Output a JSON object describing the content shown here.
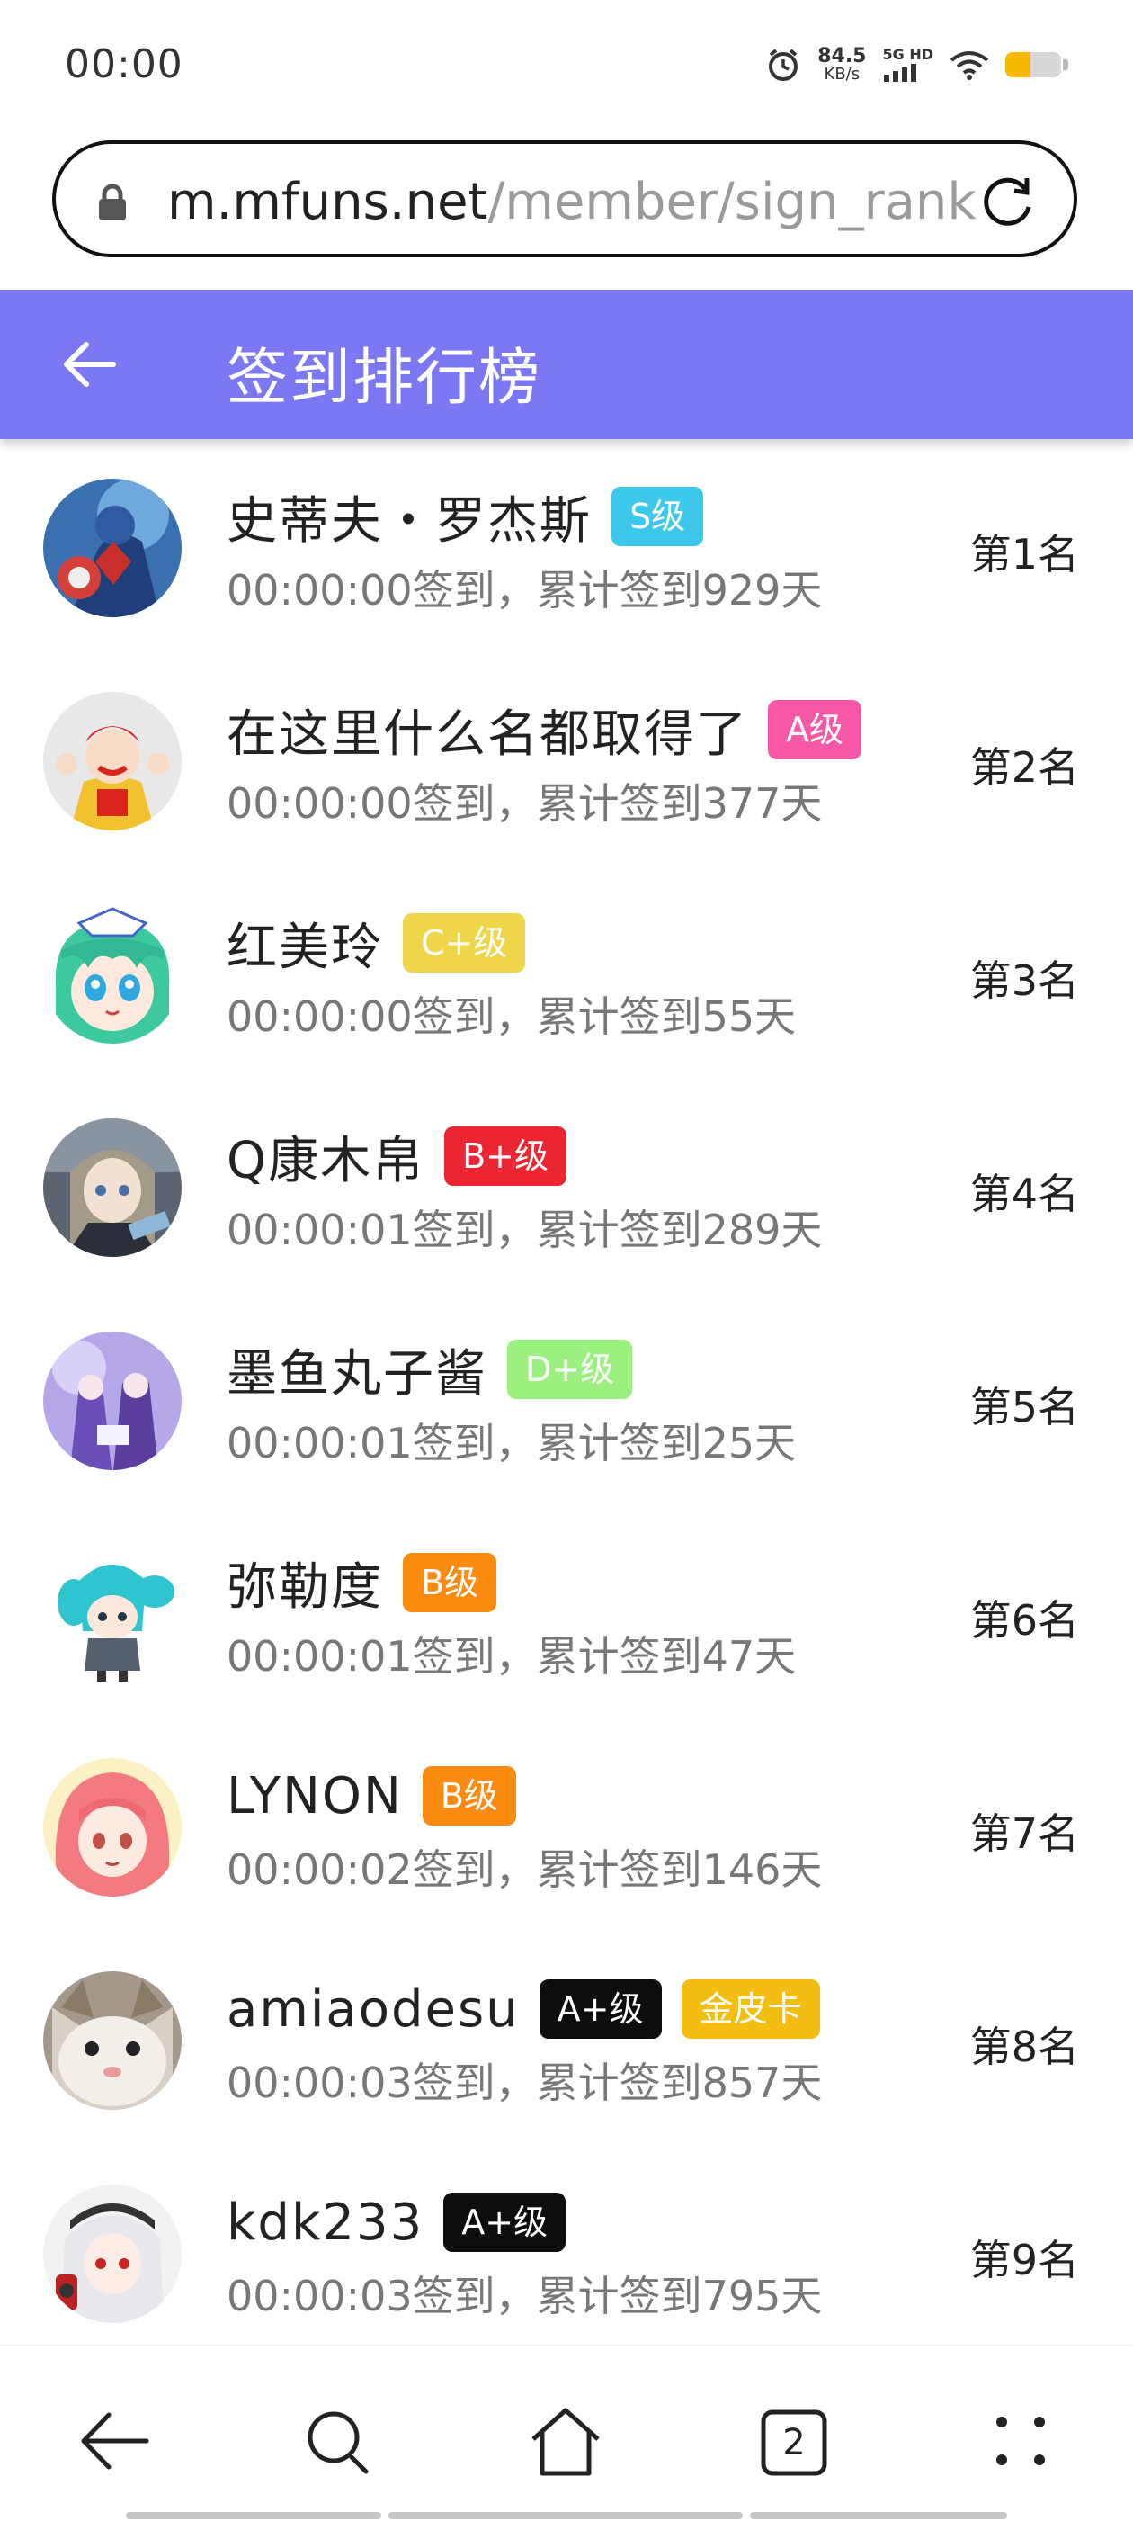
{
  "status_bar": {
    "time": "00:00",
    "net_speed_value": "84.5",
    "net_speed_unit": "KB/s",
    "network_label": "5G HD",
    "battery_level": 0.45,
    "battery_color": "#f6b800"
  },
  "browser": {
    "url_host": "m.mfuns.net",
    "url_path": "/member/sign_rank",
    "tab_count": "2"
  },
  "header": {
    "title": "签到排行榜",
    "color": "#7c78f4"
  },
  "rows": [
    {
      "name": "史蒂夫・罗杰斯",
      "badges": [
        {
          "text": "S级",
          "color": "#3cc8ea"
        }
      ],
      "sign_info": "00:00:00签到，累计签到929天",
      "rank": "第1名"
    },
    {
      "name": "在这里什么名都取得了",
      "badges": [
        {
          "text": "A级",
          "color": "#f857a6"
        }
      ],
      "sign_info": "00:00:00签到，累计签到377天",
      "rank": "第2名"
    },
    {
      "name": "红美玲",
      "badges": [
        {
          "text": "C+级",
          "color": "#efd54a"
        }
      ],
      "sign_info": "00:00:00签到，累计签到55天",
      "rank": "第3名"
    },
    {
      "name": "Q康木帛",
      "badges": [
        {
          "text": "B+级",
          "color": "#ec2533"
        }
      ],
      "sign_info": "00:00:01签到，累计签到289天",
      "rank": "第4名"
    },
    {
      "name": "墨鱼丸子酱",
      "badges": [
        {
          "text": "D+级",
          "color": "#9cf080"
        }
      ],
      "sign_info": "00:00:01签到，累计签到25天",
      "rank": "第5名"
    },
    {
      "name": "弥勒度",
      "badges": [
        {
          "text": "B级",
          "color": "#fa8a10"
        }
      ],
      "sign_info": "00:00:01签到，累计签到47天",
      "rank": "第6名"
    },
    {
      "name": "LYNON",
      "badges": [
        {
          "text": "B级",
          "color": "#fa8a10"
        }
      ],
      "sign_info": "00:00:02签到，累计签到146天",
      "rank": "第7名"
    },
    {
      "name": "amiaodesu",
      "badges": [
        {
          "text": "A+级",
          "color": "#0d0d0d"
        },
        {
          "text": "金皮卡",
          "color": "#f4bd12"
        }
      ],
      "sign_info": "00:00:03签到，累计签到857天",
      "rank": "第8名"
    },
    {
      "name": "kdk233",
      "badges": [
        {
          "text": "A+级",
          "color": "#0d0d0d"
        }
      ],
      "sign_info": "00:00:03签到，累计签到795天",
      "rank": "第9名"
    }
  ],
  "icons": {
    "status": [
      "alarm-icon",
      "signal-icon",
      "wifi-icon",
      "battery-icon"
    ],
    "browser": [
      "lock-icon",
      "reload-icon"
    ],
    "header": [
      "back-arrow-icon"
    ],
    "bottom_nav": [
      "back-arrow-icon",
      "search-icon",
      "home-icon",
      "tabs-icon",
      "menu-dots-icon"
    ]
  }
}
